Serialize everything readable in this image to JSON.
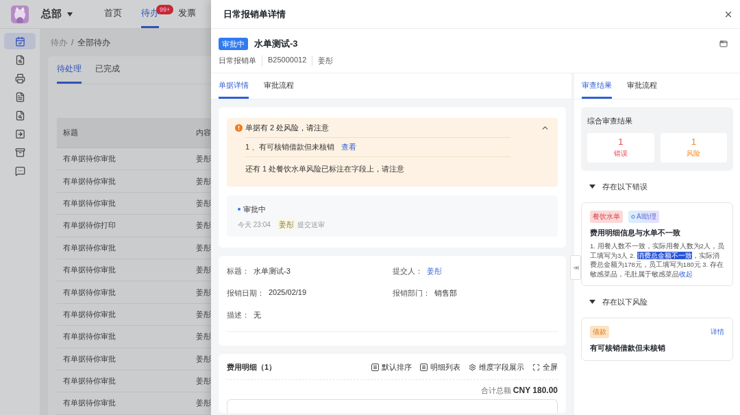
{
  "app": {
    "org": "总部",
    "nav": [
      {
        "label": "首页",
        "selected": false
      },
      {
        "label": "待办",
        "selected": true,
        "badge": "99+"
      },
      {
        "label": "发票",
        "selected": false
      }
    ],
    "sidebar": [
      {
        "kind": "calendar",
        "selected": true
      },
      {
        "kind": "file-search",
        "selected": false
      },
      {
        "kind": "printer",
        "selected": false
      },
      {
        "kind": "file",
        "selected": false
      },
      {
        "kind": "file-search",
        "selected": false
      },
      {
        "kind": "arrow-box",
        "selected": false
      },
      {
        "kind": "archive",
        "selected": false
      },
      {
        "kind": "message",
        "selected": false
      }
    ],
    "breadcrumb": [
      "待办",
      "全部待办"
    ],
    "breadcrumb_separator": "/",
    "tabs": [
      {
        "label": "待处理",
        "selected": true
      },
      {
        "label": "已完成",
        "selected": false
      }
    ],
    "table": {
      "columns": [
        "标题",
        "内容"
      ],
      "rows": [
        {
          "title": "有单据待你审批",
          "content": "姜彤"
        },
        {
          "title": "有单据待你审批",
          "content": "姜彤"
        },
        {
          "title": "有单据待你审批",
          "content": "姜彤"
        },
        {
          "title": "有单据待你打印",
          "content": "姜彤"
        },
        {
          "title": "有单据待你审批",
          "content": "姜彤"
        },
        {
          "title": "有单据待你审批",
          "content": "姜彤"
        },
        {
          "title": "有单据待你审批",
          "content": "姜彤"
        },
        {
          "title": "有单据待你审批",
          "content": "姜彤"
        },
        {
          "title": "有单据待你审批",
          "content": "姜彤"
        },
        {
          "title": "有单据待你审批",
          "content": "姜彤"
        },
        {
          "title": "有单据待你审批",
          "content": "姜彤"
        },
        {
          "title": "有单据待你审批",
          "content": "姜彤"
        }
      ]
    }
  },
  "drawer": {
    "title": "日常报销单详情",
    "status": "审批中",
    "doc_title": "水单测试-3",
    "meta": [
      "日常报销单",
      "B25000012",
      "姜彤"
    ],
    "tabs": [
      {
        "label": "单据详情",
        "selected": true
      },
      {
        "label": "审批流程",
        "selected": false
      }
    ],
    "risk_alert": {
      "title": "单据有 2 处风险，请注意",
      "expanded": true,
      "items": [
        {
          "text": "1 、有可核销借款但未核销",
          "link": "查看"
        }
      ],
      "note": "还有 1 处餐饮水单风险已标注在字段上，请注意"
    },
    "approval": {
      "status": "审批中",
      "time": "今天 23:04",
      "person": "姜彤",
      "action": "提交送审"
    },
    "fields": [
      {
        "label": "标题：",
        "value": "水单测试-3",
        "link": false
      },
      {
        "label": "提交人：",
        "value": "姜彤",
        "link": true
      },
      {
        "label": "报销日期：",
        "value": "2025/02/19",
        "link": false
      },
      {
        "label": "报销部门：",
        "value": "销售部",
        "link": false
      },
      {
        "label": "描述：",
        "value": "无",
        "link": false
      }
    ],
    "expense": {
      "title": "费用明细（1）",
      "actions": [
        {
          "kind": "list",
          "label": "默认排序"
        },
        {
          "kind": "list",
          "label": "明细列表"
        },
        {
          "kind": "gear",
          "label": "维度字段展示"
        },
        {
          "kind": "fullscreen",
          "label": "全屏"
        }
      ],
      "total_label": "合计总额",
      "total": "CNY 180.00"
    },
    "review": {
      "tabs": [
        {
          "label": "审查结果",
          "selected": true
        },
        {
          "label": "审批流程",
          "selected": false
        }
      ],
      "summary": {
        "title": "综合审查结果",
        "stats": [
          {
            "value": "1",
            "label": "错误",
            "color": "#e5484d"
          },
          {
            "value": "1",
            "label": "风险",
            "color": "#f08a24"
          }
        ]
      },
      "sections": [
        {
          "title": "存在以下错误",
          "expanded": true,
          "cards": [
            {
              "tags": [
                {
                  "kind": "category",
                  "label": "餐饮水单"
                },
                {
                  "kind": "ai",
                  "label": "AI助理"
                }
              ],
              "title": "费用明细信息与水单不一致",
              "body": [
                {
                  "text": "1. 用餐人数不一致，实际用餐人数为2人，员工填写为3人 2. ",
                  "selected": false
                },
                {
                  "text": "消费总金额不一致",
                  "selected": true
                },
                {
                  "text": "，实际消费总金额为178元，员工填写为180元 3. 存在敏感菜品，毛肚属于敏感菜品",
                  "selected": false
                }
              ],
              "link": "收起"
            }
          ]
        },
        {
          "title": "存在以下风险",
          "expanded": true,
          "cards": [
            {
              "tags": [
                {
                  "kind": "loan",
                  "label": "借款"
                }
              ],
              "detail": "详情",
              "title": "有可核销借款但未核销"
            }
          ]
        }
      ]
    }
  }
}
